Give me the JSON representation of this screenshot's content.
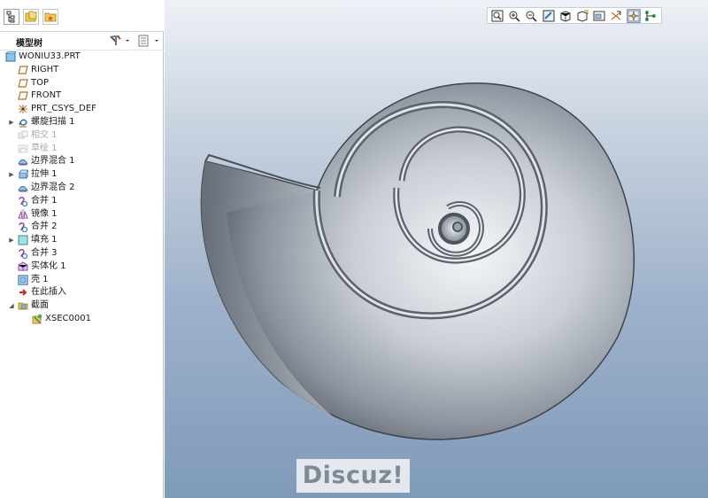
{
  "panel": {
    "title": "模型树",
    "tabs": [
      "model-tree-tab",
      "folder-browser-tab",
      "favorites-tab"
    ]
  },
  "tree": {
    "items": [
      {
        "label": "WONIU33.PRT",
        "icon": "part-icon",
        "expand": false,
        "level": 0,
        "dim": false
      },
      {
        "label": "RIGHT",
        "icon": "datum-plane-icon",
        "expand": false,
        "level": 1,
        "dim": false
      },
      {
        "label": "TOP",
        "icon": "datum-plane-icon",
        "expand": false,
        "level": 1,
        "dim": false
      },
      {
        "label": "FRONT",
        "icon": "datum-plane-icon",
        "expand": false,
        "level": 1,
        "dim": false
      },
      {
        "label": "PRT_CSYS_DEF",
        "icon": "csys-icon",
        "expand": false,
        "level": 1,
        "dim": false
      },
      {
        "label": "螺旋扫描 1",
        "icon": "helical-sweep-icon",
        "expand": true,
        "level": 1,
        "dim": false
      },
      {
        "label": "相交 1",
        "icon": "intersect-icon",
        "expand": false,
        "level": 1,
        "dim": true
      },
      {
        "label": "草绘 1",
        "icon": "sketch-icon",
        "expand": false,
        "level": 1,
        "dim": true
      },
      {
        "label": "边界混合 1",
        "icon": "boundary-blend-icon",
        "expand": false,
        "level": 1,
        "dim": false
      },
      {
        "label": "拉伸 1",
        "icon": "extrude-icon",
        "expand": true,
        "level": 1,
        "dim": false
      },
      {
        "label": "边界混合 2",
        "icon": "boundary-blend-icon",
        "expand": false,
        "level": 1,
        "dim": false
      },
      {
        "label": "合并 1",
        "icon": "merge-icon",
        "expand": false,
        "level": 1,
        "dim": false
      },
      {
        "label": "镜像 1",
        "icon": "mirror-icon",
        "expand": false,
        "level": 1,
        "dim": false
      },
      {
        "label": "合并 2",
        "icon": "merge-icon",
        "expand": false,
        "level": 1,
        "dim": false
      },
      {
        "label": "填充 1",
        "icon": "fill-icon",
        "expand": true,
        "level": 1,
        "dim": false
      },
      {
        "label": "合并 3",
        "icon": "merge-icon",
        "expand": false,
        "level": 1,
        "dim": false
      },
      {
        "label": "实体化 1",
        "icon": "solidify-icon",
        "expand": false,
        "level": 1,
        "dim": false
      },
      {
        "label": "壳 1",
        "icon": "shell-icon",
        "expand": false,
        "level": 1,
        "dim": false
      },
      {
        "label": "在此插入",
        "icon": "insert-here-icon",
        "expand": false,
        "level": 1,
        "dim": false
      },
      {
        "label": "截面",
        "icon": "sections-folder-icon",
        "expand": true,
        "expanded": true,
        "level": 1,
        "dim": false
      },
      {
        "label": "XSEC0001",
        "icon": "xsection-icon",
        "expand": false,
        "level": 2,
        "dim": false
      }
    ]
  },
  "toolbar": {
    "buttons": [
      "refit-icon",
      "zoom-in-icon",
      "zoom-out-icon",
      "repaint-icon",
      "display-style-icon",
      "saved-orientations-icon",
      "view-manager-icon",
      "datum-display-icon",
      "spin-center-icon",
      "annotation-display-icon"
    ]
  },
  "watermark": {
    "text": "Discuz!"
  },
  "colors": {
    "accent": "#f0c040",
    "datum": "#c07a30",
    "merge": "#9050a0"
  }
}
